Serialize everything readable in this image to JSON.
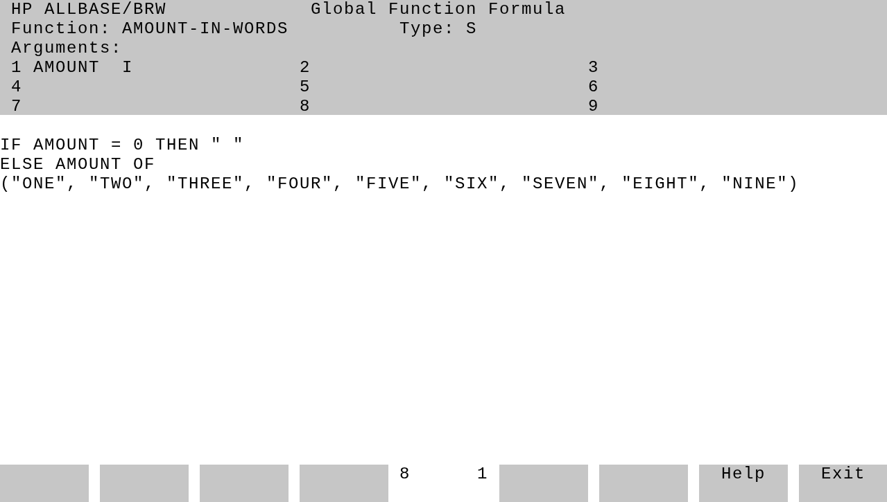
{
  "header": {
    "app_title": "HP ALLBASE/BRW",
    "screen_title": "Global Function Formula",
    "function": {
      "label": "Function:",
      "value": "AMOUNT-IN-WORDS"
    },
    "type": {
      "label": "Type:",
      "value": "S"
    },
    "arguments_label": "Arguments:",
    "arguments": [
      {
        "number": "1",
        "name": "AMOUNT",
        "type": "I"
      },
      {
        "number": "2"
      },
      {
        "number": "3"
      },
      {
        "number": "4"
      },
      {
        "number": "5"
      },
      {
        "number": "6"
      },
      {
        "number": "7"
      },
      {
        "number": "8"
      },
      {
        "number": "9"
      }
    ]
  },
  "formula": [
    "IF AMOUNT = 0 THEN \" \"",
    "ELSE AMOUNT OF",
    "(\"ONE\", \"TWO\", \"THREE\", \"FOUR\", \"FIVE\", \"SIX\", \"SEVEN\", \"EIGHT\", \"NINE\")"
  ],
  "function_keys": [
    {
      "kind": "blank"
    },
    {
      "kind": "blank"
    },
    {
      "kind": "blank"
    },
    {
      "kind": "blank"
    },
    {
      "kind": "blank"
    },
    {
      "kind": "blank"
    },
    {
      "kind": "labeled",
      "label": "Help"
    },
    {
      "kind": "labeled",
      "label": "Exit"
    }
  ],
  "indicators": [
    "8",
    "1"
  ]
}
